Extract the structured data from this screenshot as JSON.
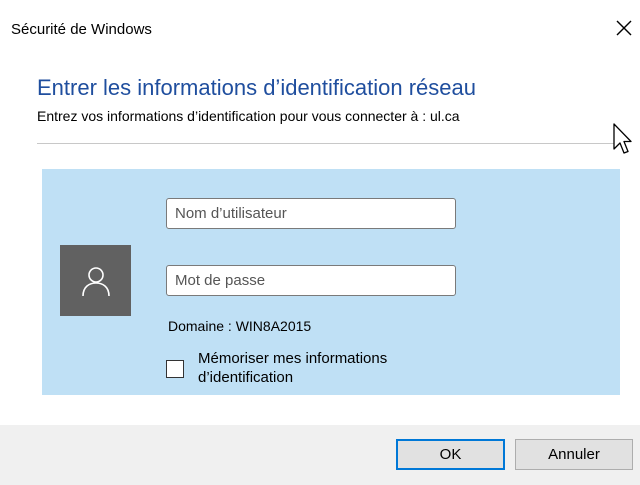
{
  "window": {
    "title": "Sécurité de Windows"
  },
  "header": {
    "heading": "Entrer les informations d’identification réseau",
    "subheading": "Entrez vos informations d’identification pour vous connecter à : ul.ca"
  },
  "form": {
    "username_placeholder": "Nom d’utilisateur",
    "username_value": "",
    "password_placeholder": "Mot de passe",
    "password_value": "",
    "domain_label": "Domaine : WIN8A2015",
    "remember_label": "Mémoriser mes informations d’identification",
    "remember_checked": false
  },
  "buttons": {
    "ok_label": "OK",
    "cancel_label": "Annuler"
  },
  "icons": {
    "close": "close-icon",
    "avatar": "user-icon",
    "cursor": "mouse-cursor-icon"
  },
  "colors": {
    "heading": "#1f4e9e",
    "panel_background": "#bfe0f5",
    "avatar_background": "#616161",
    "default_button_border": "#0078d7"
  }
}
